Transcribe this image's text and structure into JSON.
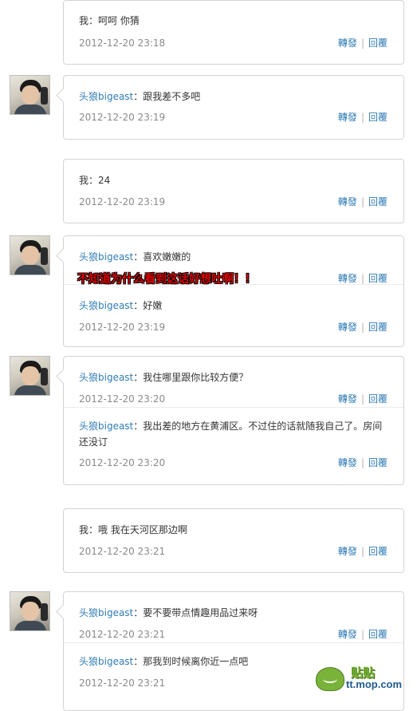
{
  "labels": {
    "forward": "轉發",
    "reply": "回覆",
    "me": "我"
  },
  "annotation": "不知道为什么看到这话好想吐啊！！",
  "watermark": {
    "tag": "贴贴",
    "site": "tt.mop.com"
  },
  "threads": [
    {
      "sender": "me",
      "messages": [
        {
          "author": "我",
          "text": "呵呵 你猜",
          "time": "2012-12-20 23:18"
        }
      ]
    },
    {
      "sender": "other",
      "messages": [
        {
          "author": "头狼bigeast",
          "text": "跟我差不多吧",
          "time": "2012-12-20 23:19"
        }
      ]
    },
    {
      "sender": "me",
      "messages": [
        {
          "author": "我",
          "text": "24",
          "time": "2012-12-20 23:19"
        }
      ]
    },
    {
      "sender": "other",
      "messages": [
        {
          "author": "头狼bigeast",
          "text": "喜欢嫩嫩的",
          "time": ""
        },
        {
          "author": "头狼bigeast",
          "text": "好嫩",
          "time": "2012-12-20 23:19"
        }
      ]
    },
    {
      "sender": "other",
      "messages": [
        {
          "author": "头狼bigeast",
          "text": "我住哪里跟你比较方便？",
          "time": "2012-12-20 23:20"
        },
        {
          "author": "头狼bigeast",
          "text": "我出差的地方在黄浦区。不过住的话就随我自己了。房间还没订",
          "time": "2012-12-20 23:20"
        }
      ]
    },
    {
      "sender": "me",
      "messages": [
        {
          "author": "我",
          "text": "哦 我在天河区那边啊",
          "time": "2012-12-20 23:21"
        }
      ]
    },
    {
      "sender": "other",
      "messages": [
        {
          "author": "头狼bigeast",
          "text": "要不要带点情趣用品过来呀",
          "time": "2012-12-20 23:21"
        },
        {
          "author": "头狼bigeast",
          "text": "那我到时候离你近一点吧",
          "time": "2012-12-20 23:21"
        }
      ]
    }
  ]
}
